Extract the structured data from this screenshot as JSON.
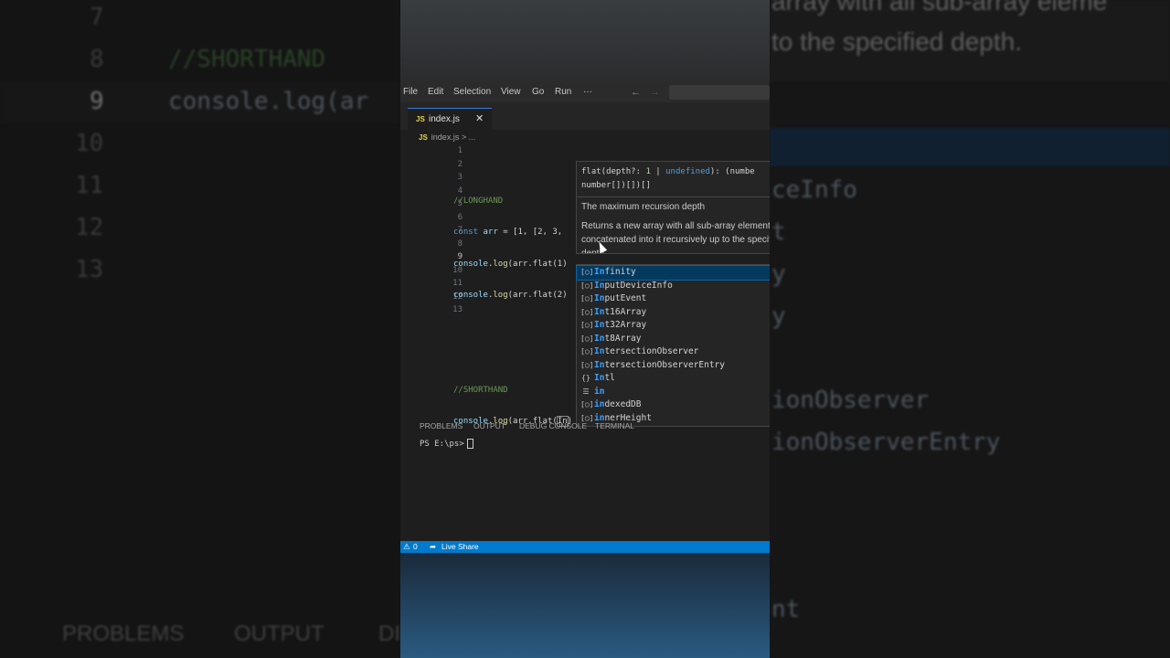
{
  "menu": [
    "File",
    "Edit",
    "Selection",
    "View",
    "Go",
    "Run",
    "···"
  ],
  "nav": {
    "back": "←",
    "forward": "→"
  },
  "tab": {
    "badge": "JS",
    "label": "index.js",
    "close": "✕"
  },
  "breadcrumb": {
    "badge": "JS",
    "file": "index.js",
    "sep": " > ",
    "more": "..."
  },
  "line_numbers": [
    "1",
    "2",
    "3",
    "4",
    "5",
    "6",
    "7",
    "8",
    "9",
    "10",
    "11",
    "12",
    "13"
  ],
  "code": {
    "l2": "//LONGHAND",
    "l3_kw": "const",
    "l3_var": " arr",
    "l3_rest": " = [1, [2, 3,",
    "l4_obj": "console",
    "l4_fn": ".log",
    "l4_rest": "(arr.flat(1)",
    "l5_obj": "console",
    "l5_fn": ".log",
    "l5_rest": "(arr.flat(2)",
    "l8": "//SHORTHAND",
    "l9_obj": "console",
    "l9_fn": ".log",
    "l9_rest": "(arr.flat(",
    "l9_typed": "In",
    "l9_end": ")"
  },
  "hover": {
    "sig_a": "flat(depth?: ",
    "sig_num": "1",
    "sig_b": " | ",
    "sig_kw": "undefined",
    "sig_c": "): (numbe",
    "sig_line2": "number[])[])[]",
    "doc1": "The maximum recursion depth",
    "doc2": "Returns a new array with all sub-array elements concatenated into it recursively up to the specified depth."
  },
  "suggestions": [
    {
      "icon": "[○]",
      "match": "In",
      "rest": "finity"
    },
    {
      "icon": "[○]",
      "match": "In",
      "rest": "putDeviceInfo"
    },
    {
      "icon": "[○]",
      "match": "In",
      "rest": "putEvent"
    },
    {
      "icon": "[○]",
      "match": "In",
      "rest": "t16Array"
    },
    {
      "icon": "[○]",
      "match": "In",
      "rest": "t32Array"
    },
    {
      "icon": "[○]",
      "match": "In",
      "rest": "t8Array"
    },
    {
      "icon": "[○]",
      "match": "In",
      "rest": "tersectionObserver"
    },
    {
      "icon": "[○]",
      "match": "In",
      "rest": "tersectionObserverEntry"
    },
    {
      "icon": "{}",
      "match": "In",
      "rest": "tl"
    },
    {
      "icon": "☰",
      "match": "in",
      "rest": ""
    },
    {
      "icon": "[○]",
      "match": "in",
      "rest": "dexedDB"
    },
    {
      "icon": "[○]",
      "match": "in",
      "rest": "nerHeight"
    }
  ],
  "panel_tabs": [
    "PROBLEMS",
    "OUTPUT",
    "DEBUG CONSOLE",
    "TERMINAL"
  ],
  "terminal": {
    "prompt": "PS E:\\ps>"
  },
  "status": {
    "problems_icon": "⚠",
    "problems_count": "0",
    "liveshare": "Live Share"
  },
  "background": {
    "left_line_numbers": [
      "7",
      "8",
      "9",
      "10",
      "11",
      "12",
      "13"
    ],
    "left_comment": "//SHORTHAND",
    "left_code": "console.log(ar",
    "left_bottom": [
      "PROBLEMS",
      "OUTPUT",
      "DI"
    ],
    "right_text_1": "array with all sub-array eleme",
    "right_text_2": "to the specified depth.",
    "right_items": [
      "ceInfo",
      "t",
      "y",
      "y",
      "ionObserver",
      "ionObserverEntry",
      "nt"
    ]
  },
  "colors": {
    "accent": "#007acc",
    "selection": "#04395e",
    "match": "#3aa0ff"
  }
}
